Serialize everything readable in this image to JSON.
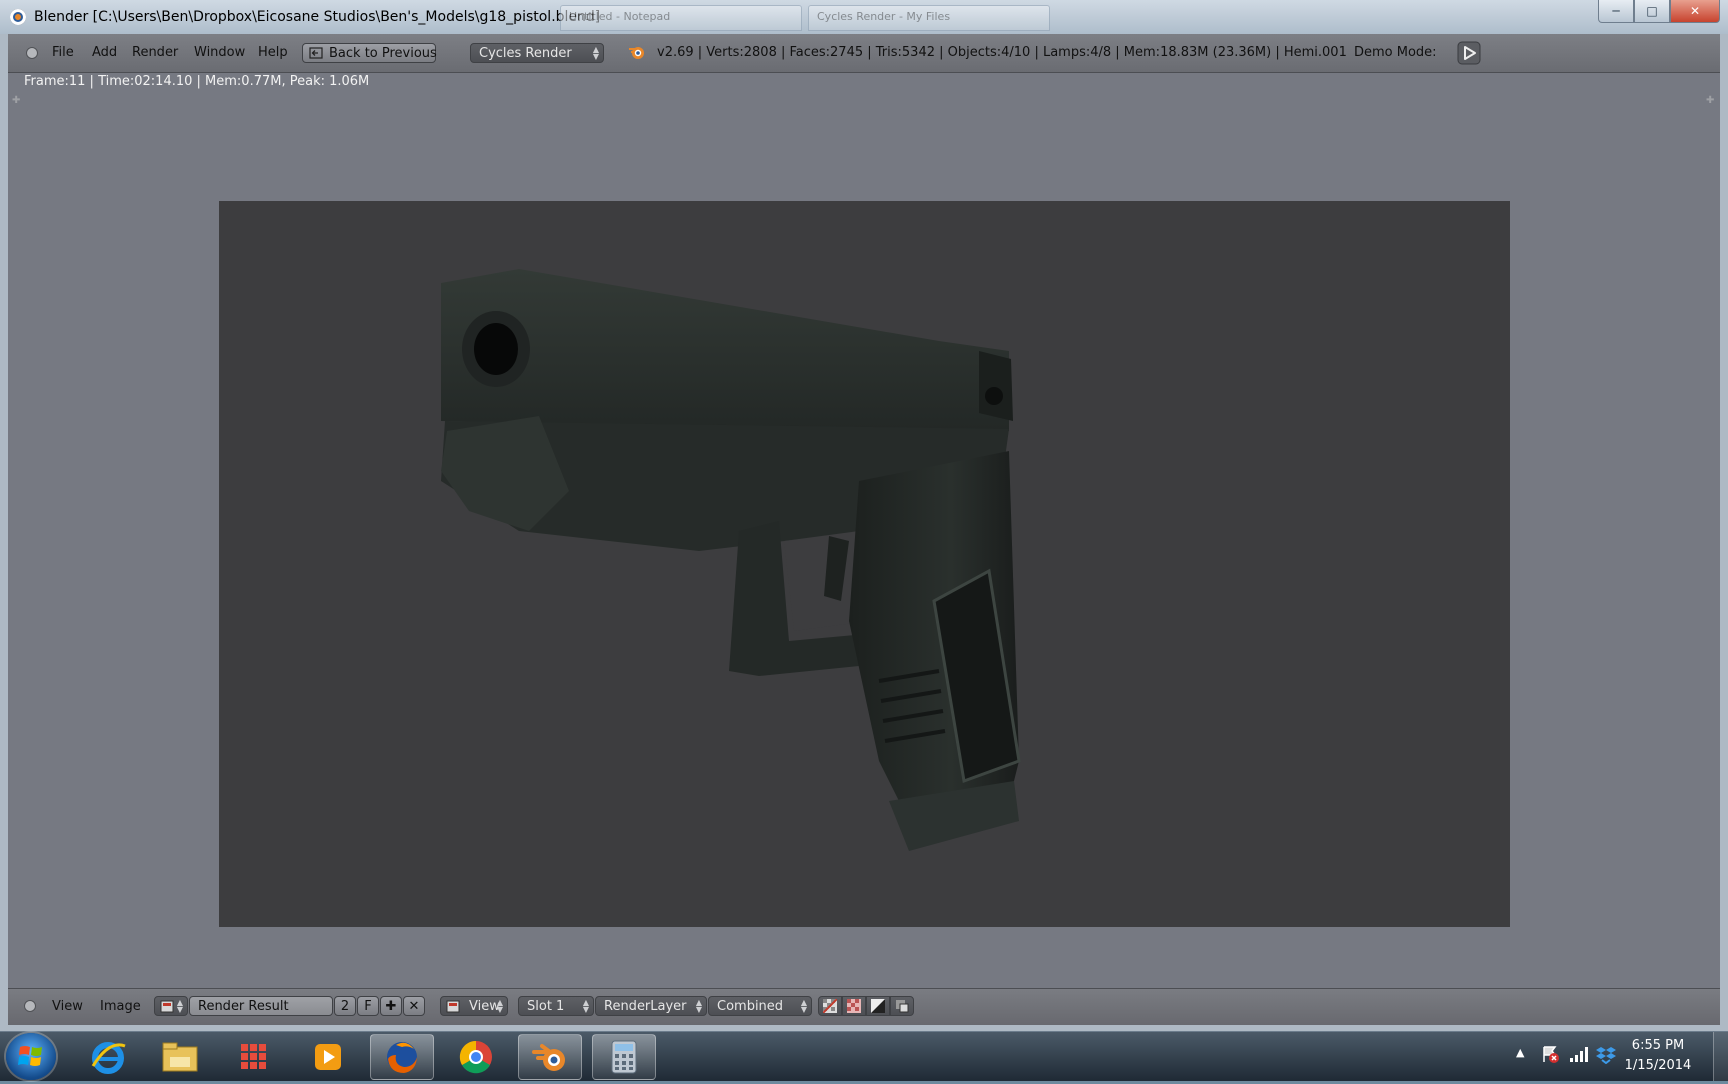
{
  "window": {
    "title": "Blender [C:\\Users\\Ben\\Dropbox\\Eicosane Studios\\Ben's_Models\\g18_pistol.blend]",
    "ghost_tabs": [
      "Untitled - Notepad",
      "Cycles Render - My Files"
    ]
  },
  "info_header": {
    "menus": [
      "File",
      "Add",
      "Render",
      "Window",
      "Help"
    ],
    "back_button": "Back to Previous",
    "render_engine": "Cycles Render",
    "stats": "v2.69 | Verts:2808 | Faces:2745 | Tris:5342 | Objects:4/10 | Lamps:4/8 | Mem:18.83M (23.36M) | Hemi.001",
    "demo_mode_label": "Demo Mode:"
  },
  "render_status": "Frame:11 | Time:02:14.10 | Mem:0.77M, Peak: 1.06M",
  "image_header": {
    "menus": [
      "View",
      "Image"
    ],
    "image_name": "Render Result",
    "users_count": "2",
    "fake_user": "F",
    "view_menu": "View",
    "slot": "Slot 1",
    "render_layer": "RenderLayer",
    "pass": "Combined"
  },
  "taskbar": {
    "apps": [
      "internet-explorer-icon",
      "file-explorer-icon",
      "metro-grid-icon",
      "media-player-icon",
      "firefox-icon",
      "chrome-icon",
      "blender-icon",
      "calculator-icon"
    ],
    "active_app": "blender-icon",
    "clock_time": "6:55 PM",
    "clock_date": "1/15/2014"
  },
  "colors": {
    "accent_blender_orange": "#e8872a",
    "render_background": "#3d3d3f",
    "viewport_background": "#767982",
    "pistol_body": "#2a302c"
  }
}
